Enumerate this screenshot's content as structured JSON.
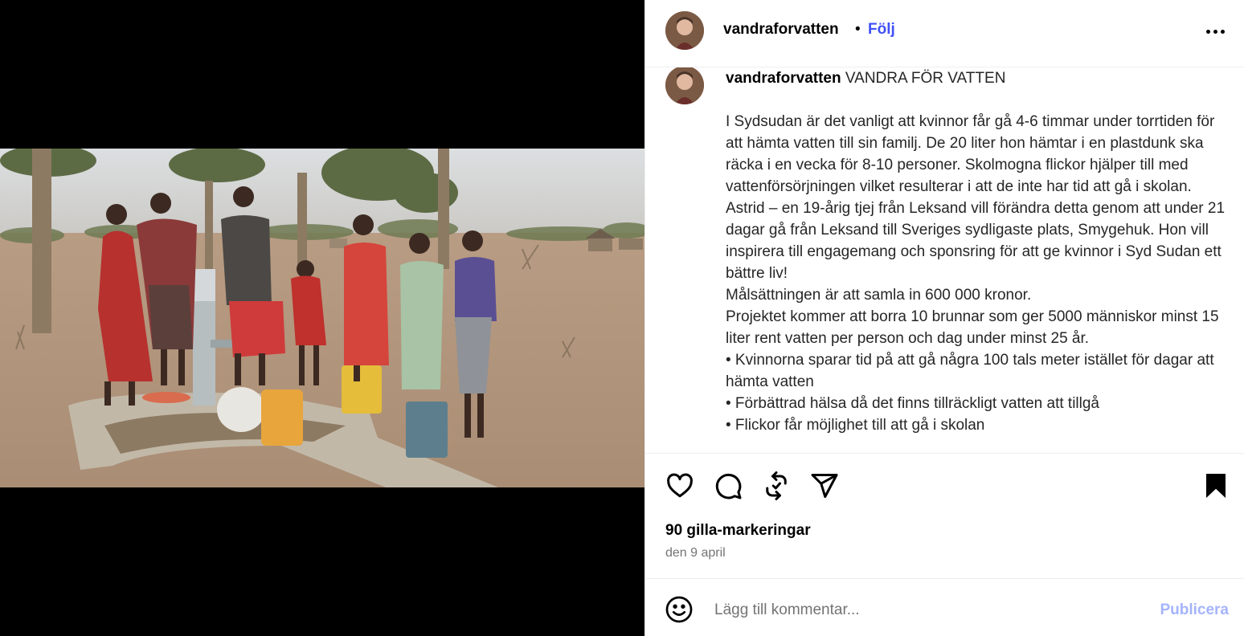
{
  "post": {
    "username": "vandraforvatten",
    "separator": "•",
    "follow_label": "Följ",
    "more_icon": "more-horizontal-icon"
  },
  "caption": {
    "username": "vandraforvatten",
    "title": "VANDRA FÖR VATTEN",
    "lines": [
      "I Sydsudan är det vanligt att kvinnor får gå 4-6 timmar under torrtiden för att hämta vatten till sin familj. De 20 liter hon hämtar i en plastdunk ska räcka i en vecka för 8-10 personer. Skolmogna flickor hjälper till med vattenförsörjningen vilket resulterar i att de inte har tid att gå i skolan.",
      "Astrid – en 19-årig tjej från Leksand vill förändra detta genom att under 21 dagar gå från Leksand till Sveriges sydligaste plats, Smygehuk. Hon vill inspirera till engagemang och sponsring för att ge kvinnor i Syd Sudan ett bättre liv!",
      "Målsättningen är att samla in 600 000 kronor.",
      "Projektet kommer att borra 10 brunnar som ger 5000 människor minst 15 liter rent vatten per person och dag under minst 25 år.",
      "• Kvinnorna sparar tid på att gå några 100 tals meter istället för dagar att hämta vatten",
      "• Förbättrad hälsa då det finns tillräckligt vatten att tillgå",
      "• Flickor får möjlighet till att gå i skolan"
    ]
  },
  "engagement": {
    "likes": "90 gilla-markeringar",
    "date": "den 9 april"
  },
  "composer": {
    "placeholder": "Lägg till kommentar...",
    "publish_label": "Publicera"
  },
  "colors": {
    "accent": "#4150f7",
    "publish_disabled": "#a5b4fc",
    "muted": "#737373"
  }
}
